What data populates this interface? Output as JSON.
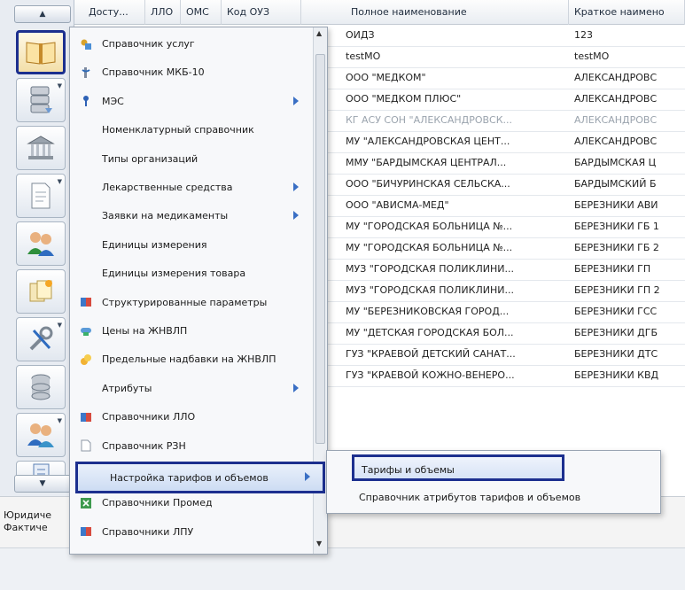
{
  "toolbar": {
    "scroll_up_icon": "triangle-up-icon",
    "scroll_down_icon": "triangle-down-icon",
    "buttons": [
      {
        "icon": "book-icon"
      },
      {
        "icon": "server-icon"
      },
      {
        "icon": "building-icon"
      },
      {
        "icon": "document-icon"
      },
      {
        "icon": "users-icon"
      },
      {
        "icon": "sticky-notes-icon"
      },
      {
        "icon": "tools-icon"
      },
      {
        "icon": "database-icon"
      },
      {
        "icon": "user-group-icon"
      },
      {
        "icon": "notebook-icon"
      }
    ]
  },
  "grid": {
    "columns": [
      "Досту...",
      "ЛЛО",
      "ОМС",
      "Код ОУЗ",
      "Полное наименование",
      "Краткое наимено"
    ],
    "rows": [
      {
        "full": "ОИДЗ",
        "short": "123"
      },
      {
        "full": "testMO",
        "short": "testMO"
      },
      {
        "full": "ООО \"МЕДКОМ\"",
        "short": "АЛЕКСАНДРОВС"
      },
      {
        "full": "ООО \"МЕДКОМ ПЛЮС\"",
        "short": "АЛЕКСАНДРОВС"
      },
      {
        "full": "КГ АСУ СОН \"АЛЕКСАНДРОВСК...",
        "short": "АЛЕКСАНДРОВС",
        "muted": true
      },
      {
        "full": "МУ \"АЛЕКСАНДРОВСКАЯ ЦЕНТ...",
        "short": "АЛЕКСАНДРОВС"
      },
      {
        "full": "ММУ \"БАРДЫМСКАЯ ЦЕНТРАЛ...",
        "short": "БАРДЫМСКАЯ Ц"
      },
      {
        "full": "ООО \"БИЧУРИНСКАЯ СЕЛЬСКА...",
        "short": "БАРДЫМСКИЙ Б"
      },
      {
        "full": "ООО \"АВИСМА-МЕД\"",
        "short": "БЕРЕЗНИКИ АВИ"
      },
      {
        "full": "МУ \"ГОРОДСКАЯ БОЛЬНИЦА №...",
        "short": "БЕРЕЗНИКИ ГБ 1"
      },
      {
        "full": "МУ \"ГОРОДСКАЯ БОЛЬНИЦА №...",
        "short": "БЕРЕЗНИКИ ГБ 2"
      },
      {
        "full": "МУЗ \"ГОРОДСКАЯ ПОЛИКЛИНИ...",
        "short": "БЕРЕЗНИКИ ГП"
      },
      {
        "full": "МУЗ \"ГОРОДСКАЯ ПОЛИКЛИНИ...",
        "short": "БЕРЕЗНИКИ ГП 2"
      },
      {
        "full": "МУ \"БЕРЕЗНИКОВСКАЯ ГОРОД...",
        "short": "БЕРЕЗНИКИ ГСС"
      },
      {
        "full": "МУ \"ДЕТСКАЯ ГОРОДСКАЯ БОЛ...",
        "short": "БЕРЕЗНИКИ ДГБ"
      },
      {
        "full": "ГУЗ \"КРАЕВОЙ ДЕТСКИЙ САНАТ...",
        "short": "БЕРЕЗНИКИ ДТС"
      },
      {
        "full": "ГУЗ \"КРАЕВОЙ КОЖНО-ВЕНЕРО...",
        "short": "БЕРЕЗНИКИ КВД"
      }
    ]
  },
  "bottom": {
    "legal_label": "Юридиче",
    "actual_label": "Фактиче"
  },
  "menu": {
    "items": [
      {
        "label": "Справочник услуг",
        "icon": "services-icon",
        "submenu": false
      },
      {
        "label": "Справочник МКБ-10",
        "icon": "medical-icon",
        "submenu": false
      },
      {
        "label": "МЭС",
        "icon": "pin-icon",
        "submenu": true
      },
      {
        "label": "Номенклатурный справочник",
        "icon": "",
        "submenu": false
      },
      {
        "label": "Типы организаций",
        "icon": "",
        "submenu": false
      },
      {
        "label": "Лекарственные средства",
        "icon": "",
        "submenu": true
      },
      {
        "label": "Заявки на медикаменты",
        "icon": "",
        "submenu": true
      },
      {
        "label": "Единицы измерения",
        "icon": "",
        "submenu": false
      },
      {
        "label": "Единицы измерения товара",
        "icon": "",
        "submenu": false
      },
      {
        "label": "Структурированные параметры",
        "icon": "book-small-icon",
        "submenu": false
      },
      {
        "label": "Цены на ЖНВЛП",
        "icon": "pills-icon",
        "submenu": false
      },
      {
        "label": "Предельные надбавки на ЖНВЛП",
        "icon": "coins-icon",
        "submenu": false
      },
      {
        "label": "Атрибуты",
        "icon": "",
        "submenu": true
      },
      {
        "label": "Справочники ЛЛО",
        "icon": "book-small-icon",
        "submenu": false
      },
      {
        "label": "Справочник РЗН",
        "icon": "page-icon",
        "submenu": false
      },
      {
        "label": "Настройка тарифов и объемов",
        "icon": "",
        "submenu": true,
        "highlight": true
      },
      {
        "label": "Справочники Промед",
        "icon": "excel-icon",
        "submenu": false
      },
      {
        "label": "Справочники ЛПУ",
        "icon": "book-small-icon",
        "submenu": false
      }
    ]
  },
  "submenu": {
    "items": [
      {
        "label": "Тарифы и объемы",
        "highlight": true
      },
      {
        "label": "Справочник атрибутов тарифов и объемов"
      }
    ]
  },
  "colors": {
    "highlight_border": "#1c2f8f",
    "submenu_arrow": "#3a6fc4"
  }
}
